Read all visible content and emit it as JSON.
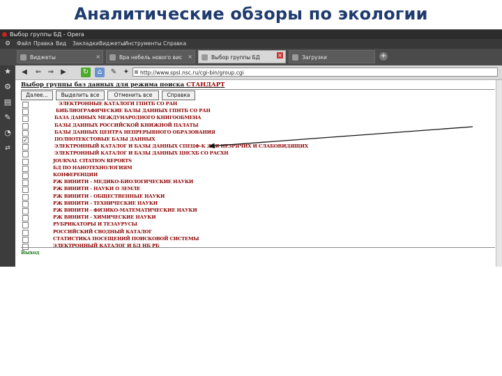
{
  "slide": {
    "title": "Аналитические обзоры по экологии"
  },
  "window": {
    "title": "Выбор группы БД - Opera"
  },
  "menu": {
    "icon": "gear-icon",
    "items": [
      "Файл",
      "Правка",
      "Вид",
      "Закладки",
      "Виджеты",
      "Инструменты",
      "Справка"
    ]
  },
  "tabs": [
    {
      "label": "Виджеты",
      "active": false
    },
    {
      "label": "Вра небель нового вис",
      "active": false
    },
    {
      "label": "Выбор группы БД",
      "active": true
    },
    {
      "label": "Загрузки",
      "active": false
    }
  ],
  "side_icons": [
    "star-icon",
    "gear-icon",
    "notes-icon",
    "wand-icon",
    "clock-icon",
    "transfer-icon"
  ],
  "address": {
    "url": "http://www.spsl.nsc.ru/cgi-bin/group.cgi"
  },
  "page": {
    "heading": "Выбор группы баз данных для режима поиска",
    "mode": "СТАНДАРТ",
    "buttons": [
      "Далее...",
      "Выделить все",
      "Отменить все",
      "Справка"
    ],
    "exit": "Выход"
  },
  "databases": [
    {
      "label": "ЭЛЕКТРОННЫЕ КАТАЛОГИ ГПНТБ СО РАН",
      "checked": false
    },
    {
      "label": "БИБЛИОГРАФИЧЕСКИЕ БАЗЫ ДАННЫХ ГПНТБ СО РАН",
      "checked": false
    },
    {
      "label": "БАЗА ДАННЫХ МЕЖДУНАРОДНОГО КНИГООБМЕНА",
      "checked": false
    },
    {
      "label": "БАЗЫ ДАННЫХ РОССИЙСКОЙ КНИЖНОЙ ПАЛАТЫ",
      "checked": false
    },
    {
      "label": "БАЗЫ ДАННЫХ ЦЕНТРА НЕПРЕРЫВНОГО ОБРАЗОВАНИЯ",
      "checked": false
    },
    {
      "label": "ПОЛНОТЕКСТОВЫЕ БАЗЫ ДАННЫХ",
      "checked": true
    },
    {
      "label": "ЭЛЕКТРОННЫЙ КАТАЛОГ И БАЗЫ ДАННЫХ СПЕЦФ-К ДЛЯ НЕЗРЯЧИХ И СЛАБОВИДЯЩИХ",
      "checked": false
    },
    {
      "label": "ЭЛЕКТРОННЫЙ КАТАЛОГ И БАЗЫ ДАННЫХ ЦНСХБ СО РАСХН",
      "checked": false
    },
    {
      "label": "JOURNAL CITATION REPORTS",
      "checked": false
    },
    {
      "label": "БД ПО НАНОТЕХНОЛОГИЯМ",
      "checked": false
    },
    {
      "label": "КОНФЕРЕНЦИИ",
      "checked": false
    },
    {
      "label": "РЖ ВИНИТИ - МЕДИКО-БИОЛОГИЧЕСКИЕ НАУКИ",
      "checked": false
    },
    {
      "label": "РЖ ВИНИТИ - НАУКИ О ЗЕМЛЕ",
      "checked": false
    },
    {
      "label": "РЖ ВИНИТИ - ОБЩЕСТВЕННЫЕ НАУКИ",
      "checked": false
    },
    {
      "label": "РЖ ВИНИТИ - ТЕХНИЧЕСКИЕ НАУКИ",
      "checked": false
    },
    {
      "label": "РЖ ВИНИТИ - ФИЗИКО-МАТЕМАТИЧЕСКИЕ НАУКИ",
      "checked": false
    },
    {
      "label": "РЖ ВИНИТИ - ХИМИЧЕСКИЕ НАУКИ",
      "checked": false
    },
    {
      "label": "РУБРИКАТОРЫ И ТЕЗАУРУСЫ",
      "checked": false
    },
    {
      "label": "РОССИЙСКИЙ СВОДНЫЙ КАТАЛОГ",
      "checked": false
    },
    {
      "label": "СТАТИСТИКА ПОСЕЩЕНИЙ ПОИСКОВОЙ СИСТЕМЫ",
      "checked": false
    },
    {
      "label": "ЭЛЕКТРОННЫЙ КАТАЛОГ И БД НБ РБ",
      "checked": false
    }
  ]
}
